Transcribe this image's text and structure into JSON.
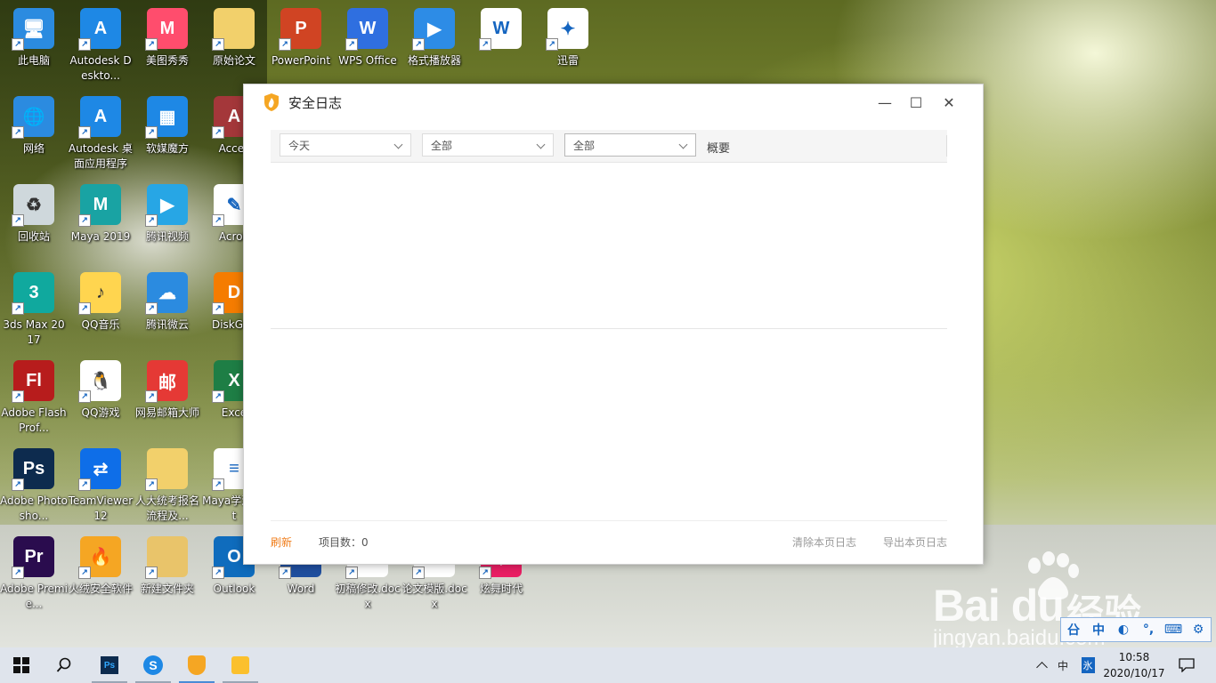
{
  "desktop": {
    "icons": [
      {
        "label": "此电脑",
        "color": "#2b8be0",
        "glyph": "🖥"
      },
      {
        "label": "Autodesk Deskto...",
        "color": "#1e88e5",
        "glyph": "A"
      },
      {
        "label": "美图秀秀",
        "color": "#ff4d6d",
        "glyph": "M"
      },
      {
        "label": "原始论文",
        "color": "#f2d06b",
        "glyph": ""
      },
      {
        "label": "PowerPoint",
        "color": "#d04423",
        "glyph": "P"
      },
      {
        "label": "WPS Office",
        "color": "#2f6fe0",
        "glyph": "W"
      },
      {
        "label": "格式播放器",
        "color": "#2d8ce6",
        "glyph": "▶"
      },
      {
        "label": "",
        "color": "#ffffff",
        "glyph": "W"
      },
      {
        "label": "迅雷",
        "color": "#ffffff",
        "glyph": "✦"
      },
      {
        "label": "网络",
        "color": "#2b8be0",
        "glyph": "🌐"
      },
      {
        "label": "Autodesk 桌面应用程序",
        "color": "#1e88e5",
        "glyph": "A"
      },
      {
        "label": "软媒魔方",
        "color": "#1e88e5",
        "glyph": "▦"
      },
      {
        "label": "Acces",
        "color": "#a4373a",
        "glyph": "A"
      },
      {
        "label": "回收站",
        "color": "#cfd8dc",
        "glyph": "♻"
      },
      {
        "label": "Maya 2019",
        "color": "#19a3a3",
        "glyph": "M"
      },
      {
        "label": "腾讯视频",
        "color": "#27a6e5",
        "glyph": "▶"
      },
      {
        "label": "Acrob",
        "color": "#ffffff",
        "glyph": "✎"
      },
      {
        "label": "3ds Max 2017",
        "color": "#10a99e",
        "glyph": "3"
      },
      {
        "label": "QQ音乐",
        "color": "#ffd54f",
        "glyph": "♪"
      },
      {
        "label": "腾讯微云",
        "color": "#2b8be0",
        "glyph": "☁"
      },
      {
        "label": "DiskGen",
        "color": "#f57c00",
        "glyph": "D"
      },
      {
        "label": "Adobe Flash Prof...",
        "color": "#b71c1c",
        "glyph": "Fl"
      },
      {
        "label": "QQ游戏",
        "color": "#ffffff",
        "glyph": "🐧"
      },
      {
        "label": "网易邮箱大师",
        "color": "#e53935",
        "glyph": "邮"
      },
      {
        "label": "Exce",
        "color": "#1e7e45",
        "glyph": "X"
      },
      {
        "label": "Adobe Photosho...",
        "color": "#0d2b4e",
        "glyph": "Ps"
      },
      {
        "label": "TeamViewer 12",
        "color": "#0e6ee8",
        "glyph": "⇄"
      },
      {
        "label": "人大统考报名流程及...",
        "color": "#f2d06b",
        "glyph": ""
      },
      {
        "label": "Maya学源.txt",
        "color": "#ffffff",
        "glyph": "≡"
      },
      {
        "label": "Adobe Premie...",
        "color": "#2a0c4e",
        "glyph": "Pr"
      },
      {
        "label": "火绒安全软件",
        "color": "#f5a623",
        "glyph": "🔥"
      },
      {
        "label": "新建文件夹",
        "color": "#e9c46a",
        "glyph": ""
      },
      {
        "label": "Outlook",
        "color": "#0f6cbd",
        "glyph": "O"
      },
      {
        "label": "Word",
        "color": "#1f4e9e",
        "glyph": "W"
      },
      {
        "label": "初稿修改.docx",
        "color": "#ffffff",
        "glyph": "≡"
      },
      {
        "label": "论文模版.docx",
        "color": "#ffffff",
        "glyph": "≡"
      },
      {
        "label": "炫舞时代",
        "color": "#e91e63",
        "glyph": "◆"
      }
    ]
  },
  "window": {
    "title": "安全日志",
    "controls": {
      "minimize": "—",
      "maximize": "☐",
      "close": "✕"
    },
    "filters": [
      {
        "value": "今天"
      },
      {
        "value": "全部"
      },
      {
        "value": "全部"
      }
    ],
    "summary_label": "概要",
    "footer": {
      "refresh": "刷新",
      "item_count_label": "项目数：0",
      "clear_page_log": "清除本页日志",
      "export_page_log": "导出本页日志"
    }
  },
  "watermark": {
    "brand": "Bai du",
    "brand_cn": "经验",
    "url": "jingyan.baidu.com"
  },
  "ime": {
    "items": [
      "㕣",
      "中",
      "◐",
      "°,",
      "⌨",
      "⚙"
    ]
  },
  "taskbar": {
    "tray_lang": "中",
    "tray_ime": "氷",
    "time": "10:58",
    "date": "2020/10/17",
    "colors": {
      "accent": "#4a8bd6",
      "orange": "#f07d1a"
    }
  }
}
